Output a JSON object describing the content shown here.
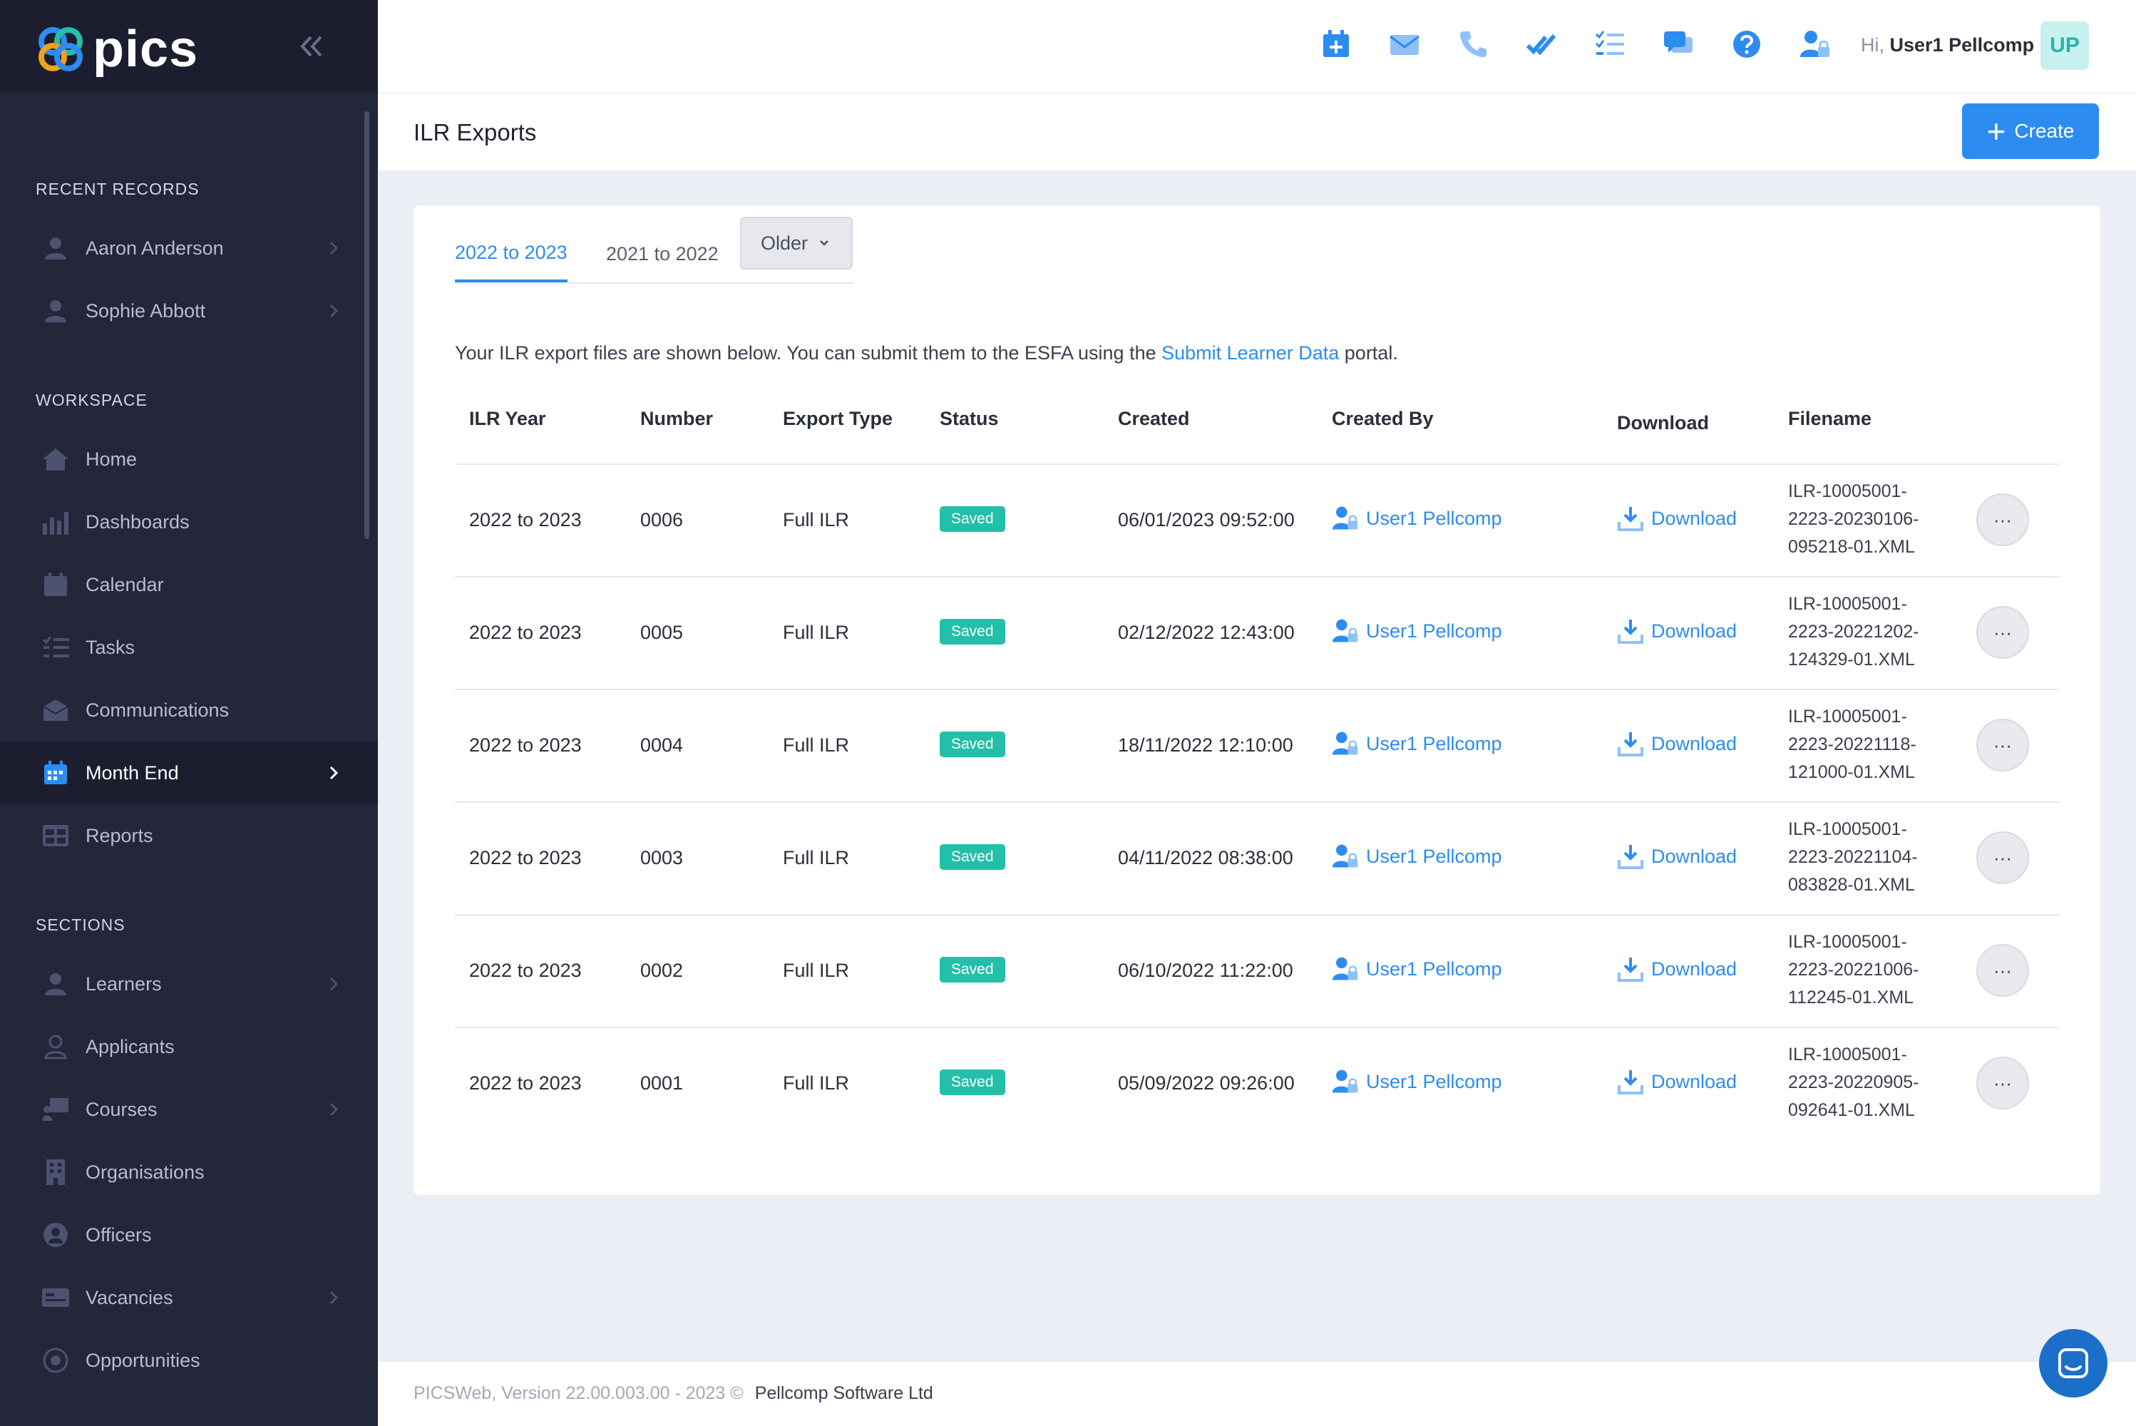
{
  "app": {
    "logo_text": "pics"
  },
  "sidebar": {
    "recent_title": "RECENT RECORDS",
    "recent": [
      {
        "label": "Aaron Anderson"
      },
      {
        "label": "Sophie Abbott"
      }
    ],
    "workspace_title": "WORKSPACE",
    "workspace": [
      {
        "label": "Home",
        "icon": "home-icon"
      },
      {
        "label": "Dashboards",
        "icon": "bar-chart-icon"
      },
      {
        "label": "Calendar",
        "icon": "calendar-icon"
      },
      {
        "label": "Tasks",
        "icon": "checklist-icon"
      },
      {
        "label": "Communications",
        "icon": "envelope-icon"
      },
      {
        "label": "Month End",
        "icon": "calendar-check-icon",
        "active": true
      },
      {
        "label": "Reports",
        "icon": "table-icon"
      }
    ],
    "sections_title": "SECTIONS",
    "sections": [
      {
        "label": "Learners",
        "icon": "person-icon"
      },
      {
        "label": "Applicants",
        "icon": "person-outline-icon"
      },
      {
        "label": "Courses",
        "icon": "presentation-icon"
      },
      {
        "label": "Organisations",
        "icon": "building-icon"
      },
      {
        "label": "Officers",
        "icon": "person-circle-icon"
      },
      {
        "label": "Vacancies",
        "icon": "card-icon"
      },
      {
        "label": "Opportunities",
        "icon": "target-icon"
      }
    ]
  },
  "header": {
    "greeting_prefix": "Hi,",
    "user_name": "User1 Pellcomp",
    "avatar_initials": "UP",
    "icons": [
      "calendar-add-icon",
      "mail-icon",
      "phone-icon",
      "double-check-icon",
      "task-list-icon",
      "chat-icon",
      "help-icon",
      "user-lock-icon"
    ]
  },
  "page": {
    "title": "ILR Exports",
    "create_label": "Create"
  },
  "tabs": {
    "items": [
      "2022 to 2023",
      "2021 to 2022"
    ],
    "active": "2022 to 2023",
    "older_label": "Older"
  },
  "intro": {
    "before": "Your ILR export files are shown below. You can submit them to the ESFA using the",
    "link": "Submit Learner Data",
    "after": "portal."
  },
  "table": {
    "headers": [
      "ILR Year",
      "Number",
      "Export Type",
      "Status",
      "Created",
      "Created By",
      "Download",
      "Filename"
    ],
    "rows": [
      {
        "year": "2022 to 2023",
        "number": "0006",
        "type": "Full ILR",
        "status": "Saved",
        "created": "06/01/2023 09:52:00",
        "by": "User1 Pellcomp",
        "download": "Download",
        "file1": "ILR-10005001-",
        "file2": "2223-20230106-",
        "file3": "095218-01.XML"
      },
      {
        "year": "2022 to 2023",
        "number": "0005",
        "type": "Full ILR",
        "status": "Saved",
        "created": "02/12/2022 12:43:00",
        "by": "User1 Pellcomp",
        "download": "Download",
        "file1": "ILR-10005001-",
        "file2": "2223-20221202-",
        "file3": "124329-01.XML"
      },
      {
        "year": "2022 to 2023",
        "number": "0004",
        "type": "Full ILR",
        "status": "Saved",
        "created": "18/11/2022 12:10:00",
        "by": "User1 Pellcomp",
        "download": "Download",
        "file1": "ILR-10005001-",
        "file2": "2223-20221118-",
        "file3": "121000-01.XML"
      },
      {
        "year": "2022 to 2023",
        "number": "0003",
        "type": "Full ILR",
        "status": "Saved",
        "created": "04/11/2022 08:38:00",
        "by": "User1 Pellcomp",
        "download": "Download",
        "file1": "ILR-10005001-",
        "file2": "2223-20221104-",
        "file3": "083828-01.XML"
      },
      {
        "year": "2022 to 2023",
        "number": "0002",
        "type": "Full ILR",
        "status": "Saved",
        "created": "06/10/2022 11:22:00",
        "by": "User1 Pellcomp",
        "download": "Download",
        "file1": "ILR-10005001-",
        "file2": "2223-20221006-",
        "file3": "112245-01.XML"
      },
      {
        "year": "2022 to 2023",
        "number": "0001",
        "type": "Full ILR",
        "status": "Saved",
        "created": "05/09/2022 09:26:00",
        "by": "User1 Pellcomp",
        "download": "Download",
        "file1": "ILR-10005001-",
        "file2": "2223-20220905-",
        "file3": "092641-01.XML"
      }
    ]
  },
  "footer": {
    "version": "PICSWeb, Version 22.00.003.00 - 2023 ©",
    "company": "Pellcomp Software Ltd"
  },
  "colors": {
    "accent": "#2d8cf0",
    "sidebar": "#24263a",
    "badge": "#24bfa9"
  }
}
